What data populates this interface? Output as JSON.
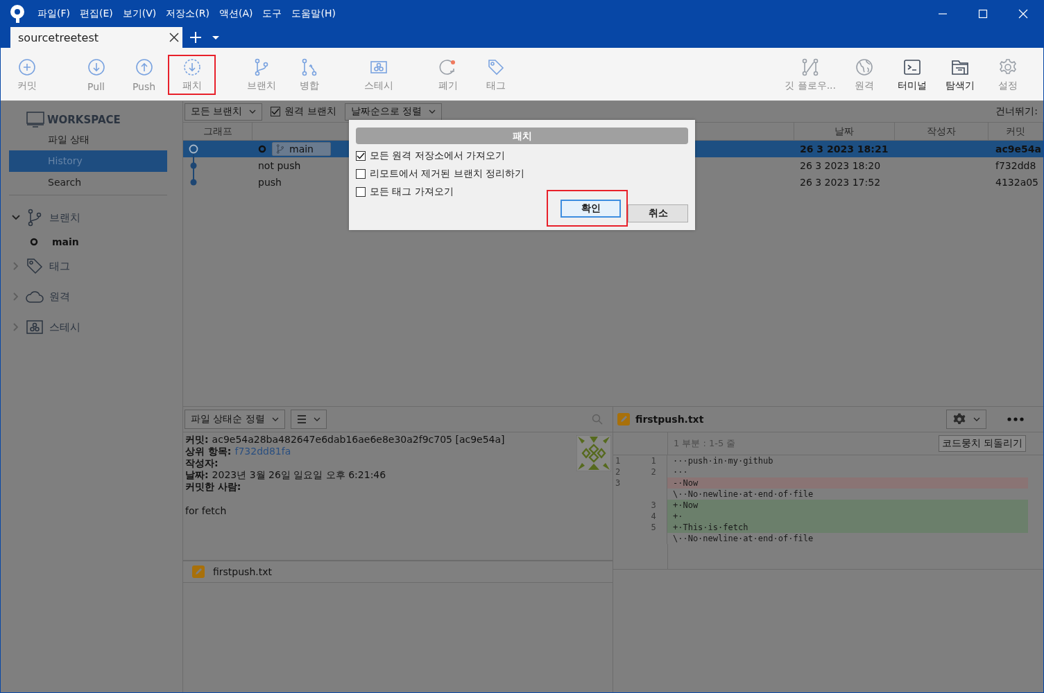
{
  "menu": [
    "파일(F)",
    "편집(E)",
    "보기(V)",
    "저장소(R)",
    "액션(A)",
    "도구",
    "도움말(H)"
  ],
  "tabs": [
    {
      "label": "sourcetreetest",
      "selected": true
    }
  ],
  "toolbar": {
    "left": [
      {
        "label": "커밋",
        "disabled": true,
        "highlighted": false
      },
      {
        "label": "Pull",
        "disabled": true,
        "highlighted": false
      },
      {
        "label": "Push",
        "disabled": true,
        "highlighted": false
      },
      {
        "label": "패치",
        "disabled": true,
        "highlighted": true
      },
      {
        "label": "브랜치",
        "disabled": true,
        "highlighted": false
      },
      {
        "label": "병합",
        "disabled": true,
        "highlighted": false
      },
      {
        "label": "스테시",
        "disabled": true,
        "highlighted": false
      },
      {
        "label": "폐기",
        "disabled": true,
        "highlighted": false
      },
      {
        "label": "태그",
        "disabled": true,
        "highlighted": false
      }
    ],
    "right": [
      {
        "label": "깃 플로우...",
        "disabled": true,
        "highlighted": false
      },
      {
        "label": "원격",
        "disabled": true,
        "highlighted": false
      },
      {
        "label": "터미널",
        "disabled": false,
        "highlighted": false
      },
      {
        "label": "탐색기",
        "disabled": false,
        "highlighted": false
      },
      {
        "label": "설정",
        "disabled": true,
        "highlighted": false
      }
    ]
  },
  "sidebar": {
    "workspace": {
      "title": "WORKSPACE",
      "items": [
        {
          "label": "파일 상태",
          "selected": false
        },
        {
          "label": "History",
          "selected": true
        },
        {
          "label": "Search",
          "selected": false
        }
      ]
    },
    "sections": [
      {
        "label": "브랜치",
        "expanded": true,
        "children": [
          {
            "label": "main",
            "current": true
          }
        ]
      },
      {
        "label": "태그",
        "expanded": false
      },
      {
        "label": "원격",
        "expanded": false
      },
      {
        "label": "스테시",
        "expanded": false
      }
    ]
  },
  "history": {
    "branch_filter": "모든 브랜치",
    "remote_branches": {
      "label": "원격 브랜치",
      "checked": true
    },
    "sort": "날짜순으로 정렬",
    "skip_label": "건너뛰기:",
    "columns": {
      "graph": "그래프",
      "date": "날짜",
      "author": "작성자",
      "commit": "커밋"
    },
    "commits": [
      {
        "branch": "main",
        "date": "26 3 2023 18:21",
        "hash": "ac9e54a",
        "selected": true
      },
      {
        "message": "not push",
        "date": "26 3 2023 18:20",
        "hash": "f732dd8",
        "selected": false
      },
      {
        "message": "push",
        "date": "26 3 2023 17:52",
        "hash": "4132a05",
        "selected": false
      }
    ]
  },
  "details": {
    "sort": "파일 상태순 정렬",
    "fields": [
      {
        "label": "커밋:",
        "value": "ac9e54a28ba482647e6dab16ae6e8e30a2f9c705 [ac9e54a]",
        "kind": "text"
      },
      {
        "label": "상위 항목:",
        "value": "f732dd81fa",
        "kind": "link"
      },
      {
        "label": "작성자:"
      },
      {
        "label": "날짜:",
        "value": "2023년 3월 26일 일요일 오후 6:21:46",
        "kind": "text"
      },
      {
        "label": "커밋한 사람:"
      }
    ],
    "message": "for fetch",
    "files": [
      {
        "name": "firstpush.txt"
      }
    ]
  },
  "diff": {
    "file": "firstpush.txt",
    "hunk": "1 부분 : 1-5 줄",
    "revert_button": "코드뭉치 되돌리기",
    "lines": [
      {
        "old": "1",
        "new": "1",
        "text": "···push·in·my·github",
        "kind": "context"
      },
      {
        "old": "2",
        "new": "2",
        "text": "···",
        "kind": "context"
      },
      {
        "old": "3",
        "text": "-·Now",
        "kind": "removed"
      },
      {
        "text": "\\··No·newline·at·end·of·file",
        "kind": "context"
      },
      {
        "new": "3",
        "text": "+·Now",
        "kind": "added"
      },
      {
        "new": "4",
        "text": "+·",
        "kind": "added"
      },
      {
        "new": "5",
        "text": "+·This·is·fetch",
        "kind": "added"
      },
      {
        "text": "\\··No·newline·at·end·of·file",
        "kind": "context"
      }
    ]
  },
  "dialog": {
    "title": "패치",
    "options": [
      {
        "label": "모든 원격 저장소에서 가져오기",
        "checked": true
      },
      {
        "label": "리모트에서 제거된 브랜치 정리하기",
        "checked": false
      },
      {
        "label": "모든 태그 가져오기",
        "checked": false
      }
    ],
    "buttons": [
      {
        "label": "확인",
        "default": true,
        "highlighted": true
      },
      {
        "label": "취소",
        "default": false,
        "highlighted": false
      }
    ]
  }
}
